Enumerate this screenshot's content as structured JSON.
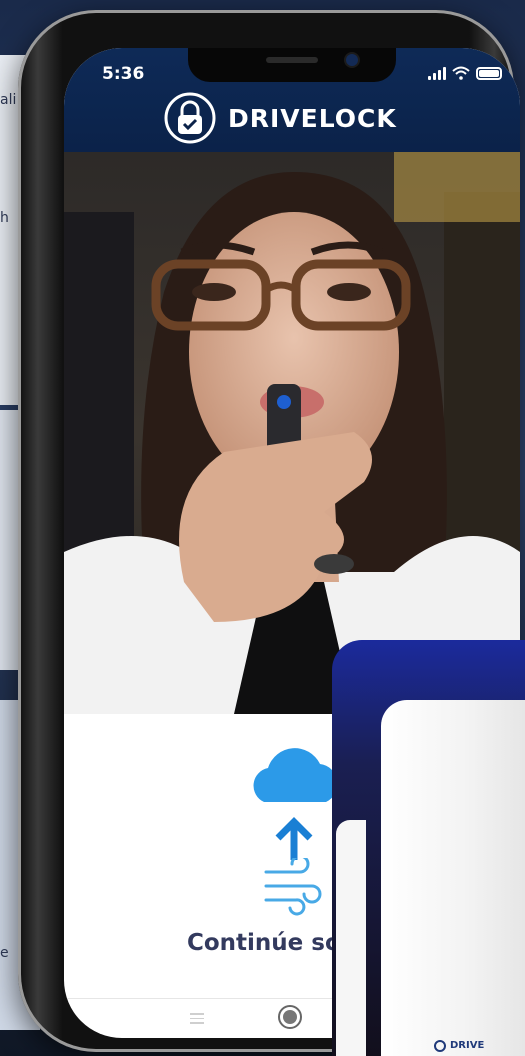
{
  "background": {
    "fragment_a": "ali",
    "fragment_b": "h",
    "fragment_c": "e"
  },
  "status_bar": {
    "time": "5:36"
  },
  "header": {
    "brand": "DRIVELOCK"
  },
  "main": {
    "instruction": "Continúe soplan"
  },
  "device": {
    "brand": "DRIVE"
  },
  "colors": {
    "header_bg": "#0b2249",
    "cloud": "#2c9ae8",
    "arrow": "#1a7fd4",
    "wind": "#48a9e6",
    "instruction_text": "#333a5e"
  },
  "icons": {
    "brand_logo": "lock-check-icon",
    "cloud": "cloud-icon",
    "arrow": "arrow-up-icon",
    "wind": "wind-icon",
    "menu": "menu-icon",
    "home": "home-button-icon"
  }
}
